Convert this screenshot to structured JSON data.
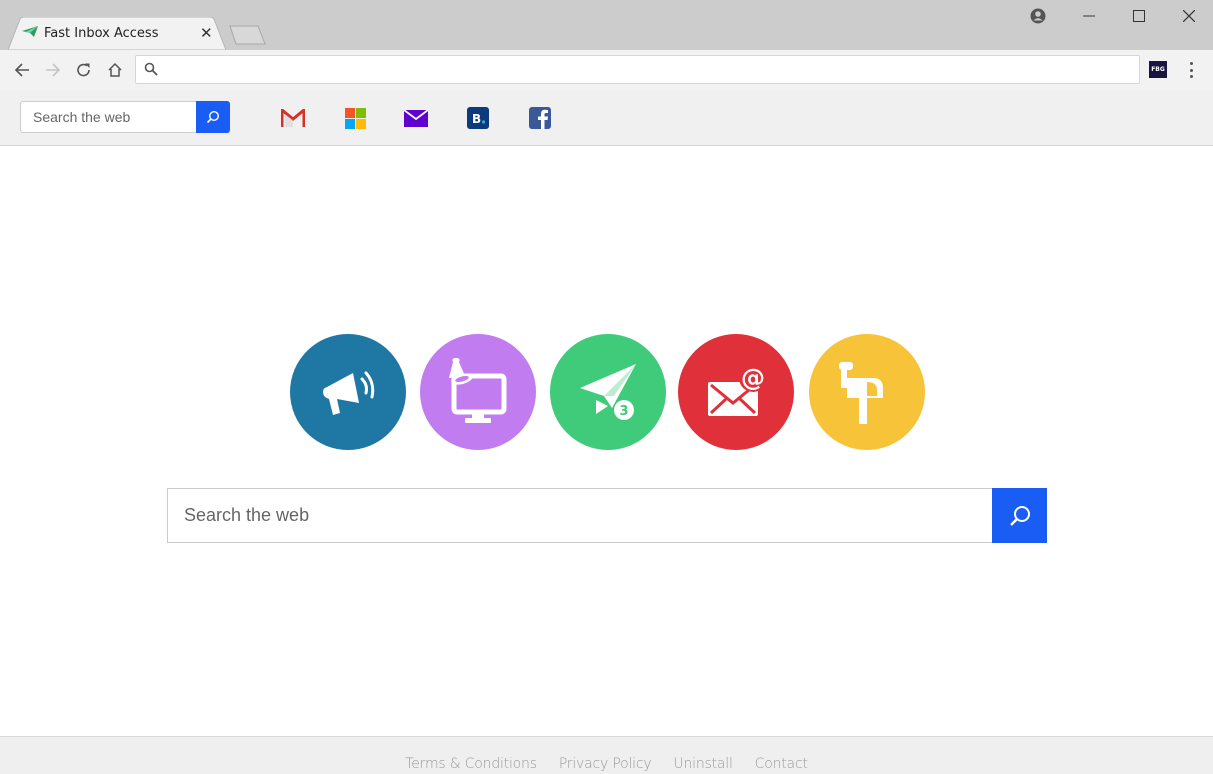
{
  "browser": {
    "tab": {
      "title": "Fast Inbox Access",
      "close_glyph": "✕",
      "favicon": "paper-plane-icon"
    },
    "window_controls": {
      "profile": "profile-icon",
      "minimize": "minimize-icon",
      "maximize": "maximize-icon",
      "close": "close-icon"
    },
    "address_bar": {
      "value": "",
      "placeholder": ""
    },
    "extension_label": "FBG"
  },
  "bookmark_bar": {
    "search": {
      "placeholder": "Search the web",
      "value": ""
    },
    "bookmarks": [
      {
        "name": "Gmail",
        "icon": "gmail-icon",
        "color": "#d93025"
      },
      {
        "name": "Outlook / Microsoft",
        "icon": "microsoft-icon"
      },
      {
        "name": "Yahoo Mail",
        "icon": "yahoo-mail-icon",
        "color": "#5f01d1"
      },
      {
        "name": "Booking.com",
        "icon": "booking-icon",
        "color": "#0c3b7c"
      },
      {
        "name": "Facebook",
        "icon": "facebook-icon",
        "color": "#3b5998"
      }
    ]
  },
  "main": {
    "circles": [
      {
        "name": "announcements",
        "icon": "megaphone-icon",
        "color": "#1f77a4"
      },
      {
        "name": "desktop-notifications",
        "icon": "monitor-bell-icon",
        "color": "#c17cf0"
      },
      {
        "name": "sent-mail",
        "icon": "paper-plane-icon",
        "color": "#3fcb7a",
        "badge": "3"
      },
      {
        "name": "email",
        "icon": "envelope-at-icon",
        "color": "#e0313a"
      },
      {
        "name": "mailbox",
        "icon": "mailbox-icon",
        "color": "#f7c339"
      }
    ],
    "search": {
      "placeholder": "Search the web",
      "value": ""
    }
  },
  "footer": {
    "links": [
      "Terms & Conditions",
      "Privacy Policy",
      "Uninstall",
      "Contact"
    ]
  },
  "colors": {
    "accent": "#1a5df5",
    "chrome": "#cccccc",
    "toolbar": "#f2f2f2"
  }
}
